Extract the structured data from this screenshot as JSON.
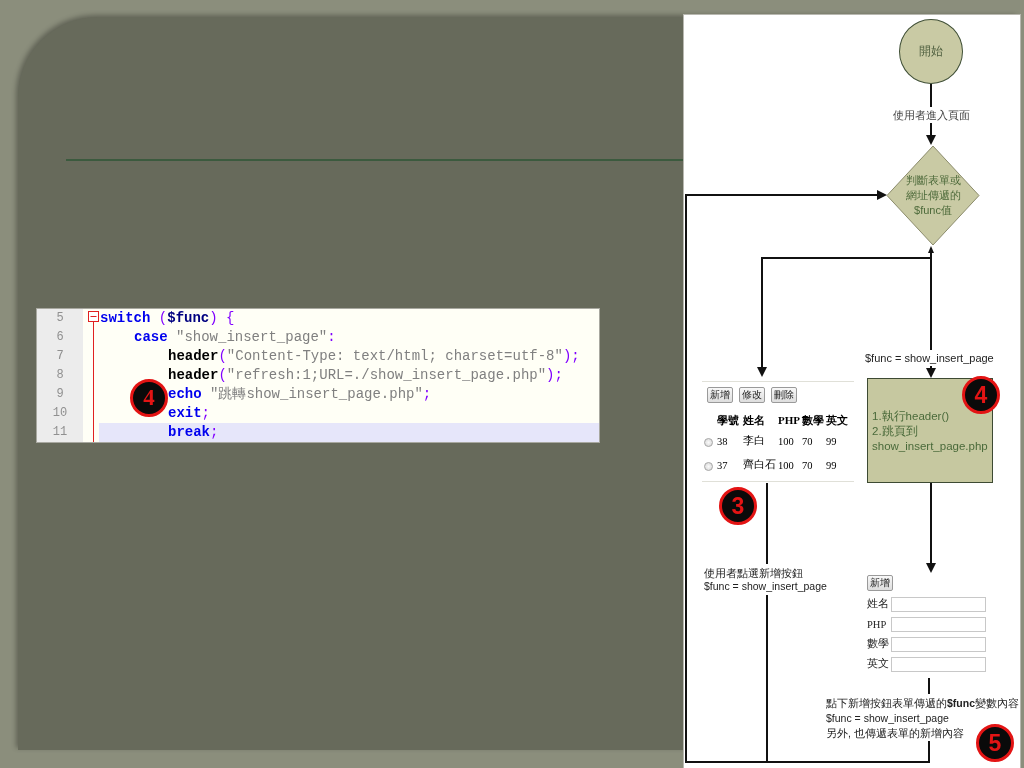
{
  "code_editor": {
    "lines": [
      {
        "number": "5",
        "fold_start": true,
        "current": false,
        "tokens": [
          {
            "kind": "keyword",
            "text": "switch"
          },
          {
            "kind": "operator",
            "text": " ("
          },
          {
            "kind": "variable",
            "text": "$func"
          },
          {
            "kind": "operator",
            "text": ") {"
          }
        ],
        "children": [
          {
            "number": "6",
            "fold_start": false,
            "current": false,
            "tokens": [
              {
                "kind": "keyword",
                "text": "case"
              },
              {
                "kind": "string",
                "text": " \"show_insert_page\""
              },
              {
                "kind": "operator",
                "text": ":"
              }
            ],
            "children": [
              {
                "number": "7",
                "fold_start": false,
                "current": false,
                "tokens": [
                  {
                    "kind": "function",
                    "text": "header"
                  },
                  {
                    "kind": "operator",
                    "text": "("
                  },
                  {
                    "kind": "string",
                    "text": "\"Content-Type: text/html; charset=utf-8\""
                  },
                  {
                    "kind": "operator",
                    "text": ");"
                  }
                ]
              },
              {
                "number": "8",
                "fold_start": false,
                "current": false,
                "tokens": [
                  {
                    "kind": "function",
                    "text": "header"
                  },
                  {
                    "kind": "operator",
                    "text": "("
                  },
                  {
                    "kind": "string",
                    "text": "\"refresh:1;URL=./show_insert_page.php\""
                  },
                  {
                    "kind": "operator",
                    "text": ");"
                  }
                ]
              },
              {
                "number": "9",
                "fold_start": false,
                "current": false,
                "tokens": [
                  {
                    "kind": "keyword",
                    "text": "echo"
                  },
                  {
                    "kind": "string",
                    "text": " \"跳轉show_insert_page.php\""
                  },
                  {
                    "kind": "operator",
                    "text": ";"
                  }
                ]
              },
              {
                "number": "10",
                "fold_start": false,
                "current": false,
                "tokens": [
                  {
                    "kind": "keyword",
                    "text": "exit"
                  },
                  {
                    "kind": "operator",
                    "text": ";"
                  }
                ]
              },
              {
                "number": "11",
                "fold_start": false,
                "current": true,
                "tokens": [
                  {
                    "kind": "keyword",
                    "text": "break"
                  },
                  {
                    "kind": "operator",
                    "text": ";"
                  }
                ]
              }
            ]
          }
        ]
      }
    ],
    "badge": "4"
  },
  "flowchart": {
    "start": {
      "label": "開始"
    },
    "entry_label": "使用者進入頁面",
    "decision": {
      "lines": [
        "判斷表單或",
        "網址傳遞的",
        "$func值"
      ]
    },
    "branch_label": "$func = show_insert_page",
    "process": {
      "lines": [
        "1.執行header()",
        "2.跳頁到",
        "show_insert_page.php"
      ],
      "badge": "4"
    },
    "list_page": {
      "buttons": [
        "新增",
        "修改",
        "刪除"
      ],
      "columns": [
        "學號",
        "姓名",
        "PHP",
        "數學",
        "英文"
      ],
      "rows": [
        {
          "selected": false,
          "cells": [
            "38",
            "李白",
            "100",
            "70",
            "99"
          ]
        },
        {
          "selected": false,
          "cells": [
            "37",
            "齊白石",
            "100",
            "70",
            "99"
          ]
        }
      ],
      "badge": "3"
    },
    "list_label": {
      "lines": [
        "使用者點選新增按鈕",
        "$func = show_insert_page"
      ]
    },
    "insert_form": {
      "button": "新增",
      "fields": [
        {
          "label": "姓名"
        },
        {
          "label": "PHP"
        },
        {
          "label": "數學"
        },
        {
          "label": "英文"
        }
      ]
    },
    "submit_label": {
      "lines": [
        "點下新增按鈕表單傳遞的**$func**變數內容",
        "$func = show_insert_page",
        "另外, 也傳遞表單的新增內容"
      ],
      "badge": "5"
    }
  }
}
